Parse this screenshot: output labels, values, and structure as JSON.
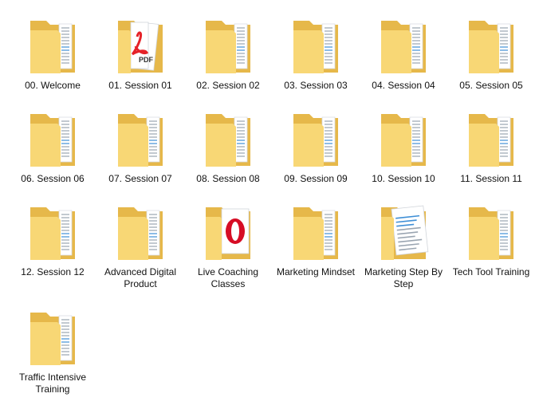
{
  "items": [
    {
      "label": "00. Welcome",
      "icon": "folder-icon"
    },
    {
      "label": "01. Session 01",
      "icon": "folder-pdf-icon"
    },
    {
      "label": "02. Session 02",
      "icon": "folder-icon"
    },
    {
      "label": "03. Session 03",
      "icon": "folder-icon"
    },
    {
      "label": "04. Session 04",
      "icon": "folder-icon"
    },
    {
      "label": "05. Session 05",
      "icon": "folder-icon"
    },
    {
      "label": "06. Session 06",
      "icon": "folder-icon"
    },
    {
      "label": "07. Session 07",
      "icon": "folder-icon"
    },
    {
      "label": "08. Session 08",
      "icon": "folder-icon"
    },
    {
      "label": "09. Session 09",
      "icon": "folder-icon"
    },
    {
      "label": "10. Session 10",
      "icon": "folder-icon"
    },
    {
      "label": "11. Session 11",
      "icon": "folder-icon"
    },
    {
      "label": "12. Session 12",
      "icon": "folder-icon"
    },
    {
      "label": "Advanced Digital Product",
      "icon": "folder-icon"
    },
    {
      "label": "Live Coaching Classes",
      "icon": "folder-opera-icon"
    },
    {
      "label": "Marketing Mindset",
      "icon": "folder-icon"
    },
    {
      "label": "Marketing Step By Step",
      "icon": "folder-document-icon"
    },
    {
      "label": "Tech Tool Training",
      "icon": "folder-icon"
    },
    {
      "label": "Traffic Intensive Training",
      "icon": "folder-icon"
    }
  ],
  "pdf_badge": "PDF",
  "colors": {
    "folder_back": "#e6b84a",
    "folder_front": "#f8d775",
    "folder_front_dark": "#f1c64f",
    "paper": "#ffffff",
    "paper_lines": "#9aa5b1",
    "paper_blue": "#3f8fd6",
    "pdf_red": "#e52228",
    "opera_red": "#d60d25"
  }
}
